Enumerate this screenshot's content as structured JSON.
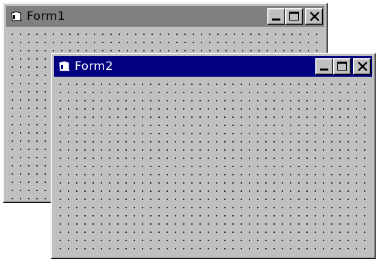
{
  "windows": {
    "form1": {
      "title": "Form1",
      "state": "inactive",
      "icon": "form-window-icon",
      "titlebar_color": "#808080",
      "buttons": [
        "minimize",
        "maximize",
        "close"
      ]
    },
    "form2": {
      "title": "Form2",
      "state": "active",
      "icon": "form-window-icon",
      "titlebar_color": "#000080",
      "buttons": [
        "minimize",
        "maximize",
        "close"
      ]
    }
  },
  "colors": {
    "face": "#c0c0c0",
    "active_title": "#000080",
    "inactive_title": "#808080",
    "grid_dot": "#000000",
    "desktop": "#ffffff"
  }
}
